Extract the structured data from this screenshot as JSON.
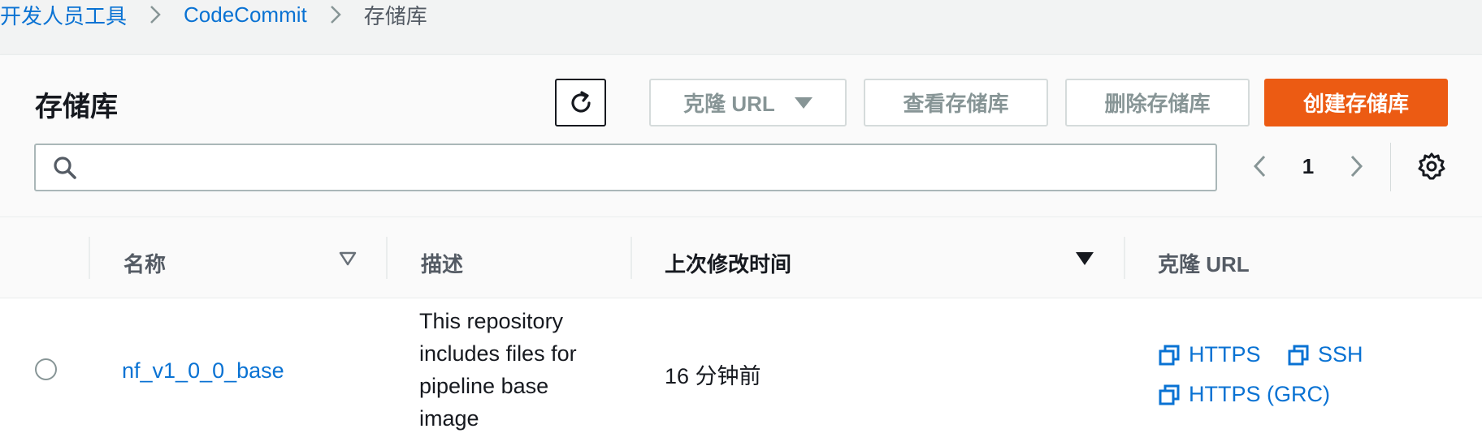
{
  "breadcrumb": {
    "items": [
      "开发人员工具",
      "CodeCommit"
    ],
    "current": "存储库"
  },
  "header": {
    "title": "存储库",
    "buttons": {
      "clone_url": "克隆 URL",
      "view": "查看存储库",
      "delete": "删除存储库",
      "create": "创建存储库"
    }
  },
  "search": {
    "value": "",
    "placeholder": ""
  },
  "pagination": {
    "current_page": "1"
  },
  "table": {
    "columns": {
      "name": "名称",
      "description": "描述",
      "last_modified": "上次修改时间",
      "clone_url": "克隆 URL"
    },
    "rows": [
      {
        "name": "nf_v1_0_0_base",
        "description": "This repository includes files for pipeline base image",
        "last_modified": "16 分钟前",
        "clone_urls": {
          "https": "HTTPS",
          "ssh": "SSH",
          "https_grc": "HTTPS (GRC)"
        }
      }
    ]
  },
  "colors": {
    "link": "#0972d3",
    "primary_button": "#ec5b13",
    "disabled_text": "#879596"
  }
}
